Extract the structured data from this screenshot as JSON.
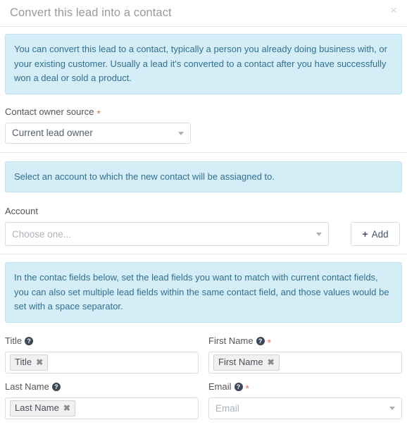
{
  "modal": {
    "title": "Convert this lead into a contact",
    "close_label": "×"
  },
  "alerts": {
    "intro": "You can convert this lead to a contact, typically a person you already doing business with, or your existing customer. Usually a lead it's converted to a contact after you have successfully won a deal or sold a product.",
    "account": "Select an account to which the new contact will be assiagned to.",
    "mapping": "In the contac fields below, set the lead fields you want to match with current contact fields, you can also set multiple lead fields within the same contact field, and those values would be set with a space separator."
  },
  "contact_owner_source": {
    "label": "Contact owner source",
    "required_marker": "*",
    "value": "Current lead owner"
  },
  "account": {
    "label": "Account",
    "placeholder": "Choose one...",
    "add_button": {
      "icon": "+",
      "label": "Add"
    }
  },
  "fields": [
    {
      "label": "Title",
      "help_icon": "?",
      "required_marker": "",
      "type": "tokens",
      "tokens": [
        "Title"
      ],
      "remove_icon": "✖"
    },
    {
      "label": "First Name",
      "help_icon": "?",
      "required_marker": "*",
      "type": "tokens",
      "tokens": [
        "First Name"
      ],
      "remove_icon": "✖"
    },
    {
      "label": "Last Name",
      "help_icon": "?",
      "required_marker": "",
      "type": "tokens",
      "tokens": [
        "Last Name"
      ],
      "remove_icon": "✖"
    },
    {
      "label": "Email",
      "help_icon": "?",
      "required_marker": "*",
      "type": "select",
      "placeholder": "Email"
    }
  ],
  "colors": {
    "alert_bg": "#d4edf7",
    "alert_text": "#31708f",
    "required": "#e8705a",
    "border": "#dcdcdc",
    "title": "#9a9a9a"
  }
}
